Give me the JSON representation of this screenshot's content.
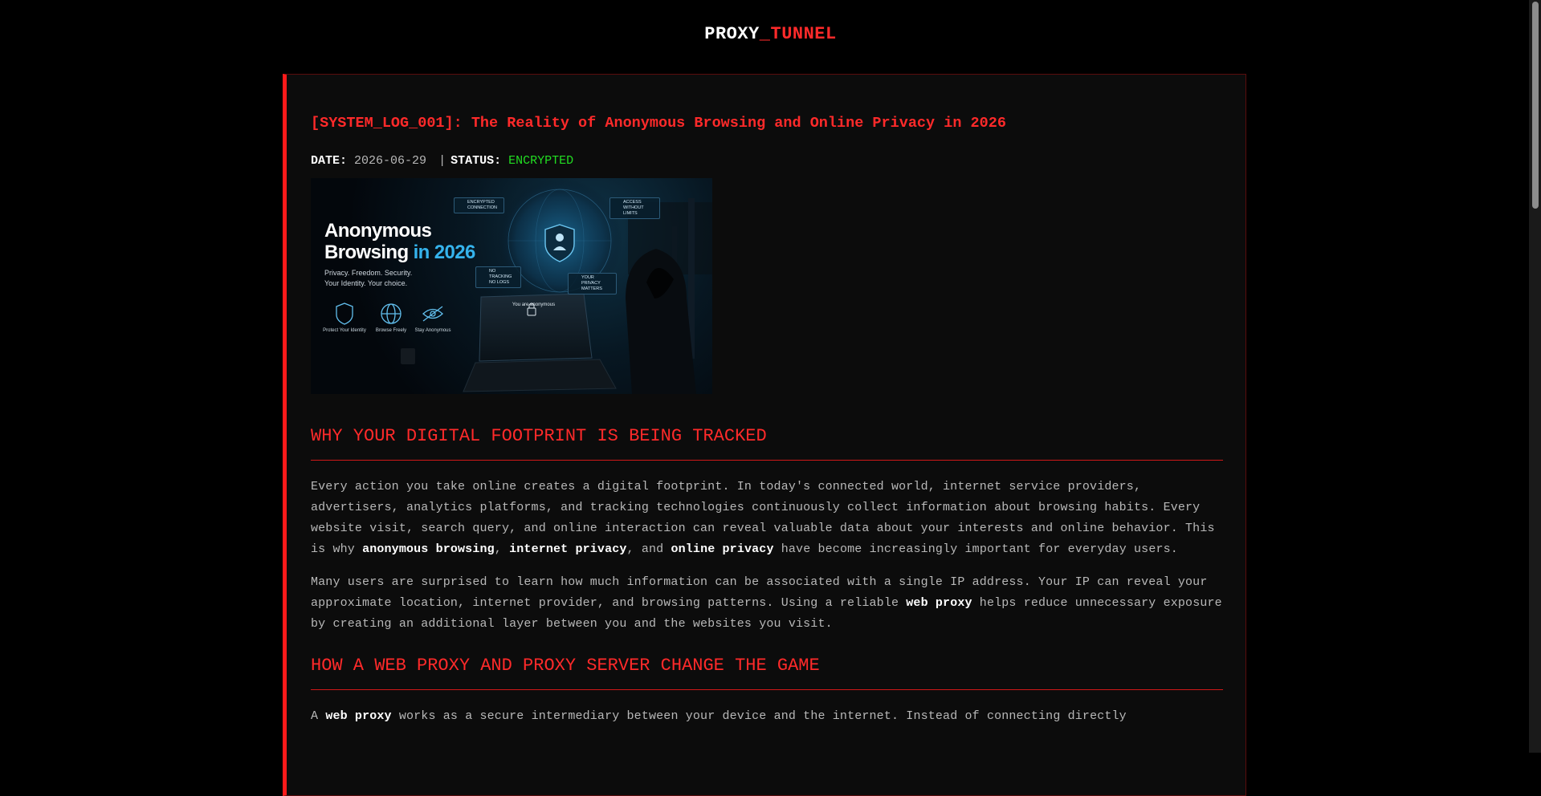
{
  "site": {
    "logo_part1": "PROXY",
    "logo_part2": "_TUNNEL"
  },
  "post": {
    "title": "[SYSTEM_LOG_001]: The Reality of Anonymous Browsing and Online Privacy in 2026",
    "date_label": "DATE:",
    "date": "2026-06-29",
    "separator": "|",
    "status_label": "STATUS:",
    "status": "ENCRYPTED"
  },
  "hero": {
    "title_line1": "Anonymous",
    "title_line2a": "Browsing ",
    "title_line2b": "in 2026",
    "tagline1": "Privacy. Freedom. Security.",
    "tagline2": "Your Identity. Your choice.",
    "feature1": "Protect Your Identity",
    "feature2": "Browse Freely",
    "feature3": "Stay Anonymous",
    "chip1": "ENCRYPTED CONNECTION",
    "chip2": "ACCESS WITHOUT LIMITS",
    "chip3": "NO TRACKING NO LOGS",
    "chip4": "YOUR PRIVACY MATTERS",
    "screen_text": "You are anonymous"
  },
  "sections": [
    {
      "heading": "WHY YOUR DIGITAL FOOTPRINT IS BEING TRACKED"
    },
    {
      "heading": "HOW A WEB PROXY AND PROXY SERVER CHANGE THE GAME"
    }
  ],
  "p1": {
    "t1": "Every action you take online creates a digital footprint. In today's connected world, internet service providers, advertisers, analytics platforms, and tracking technologies continuously collect information about browsing habits. Every website visit, search query, and online interaction can reveal valuable data about your interests and online behavior. This is why ",
    "b1": "anonymous browsing",
    "t2": ", ",
    "b2": "internet privacy",
    "t3": ", and ",
    "b3": "online privacy",
    "t4": " have become increasingly important for everyday users."
  },
  "p2": {
    "t1": "Many users are surprised to learn how much information can be associated with a single IP address. Your IP can reveal your approximate location, internet provider, and browsing patterns. Using a reliable ",
    "b1": "web proxy",
    "t2": " helps reduce unnecessary exposure by creating an additional layer between you and the websites you visit."
  },
  "p3": {
    "t1": "A ",
    "b1": "web proxy",
    "t2": " works as a secure intermediary between your device and the internet. Instead of connecting directly"
  },
  "colors": {
    "accent": "#ff2a2a",
    "status_ok": "#22dd22",
    "background": "#000000",
    "card": "#0c0c0c"
  }
}
